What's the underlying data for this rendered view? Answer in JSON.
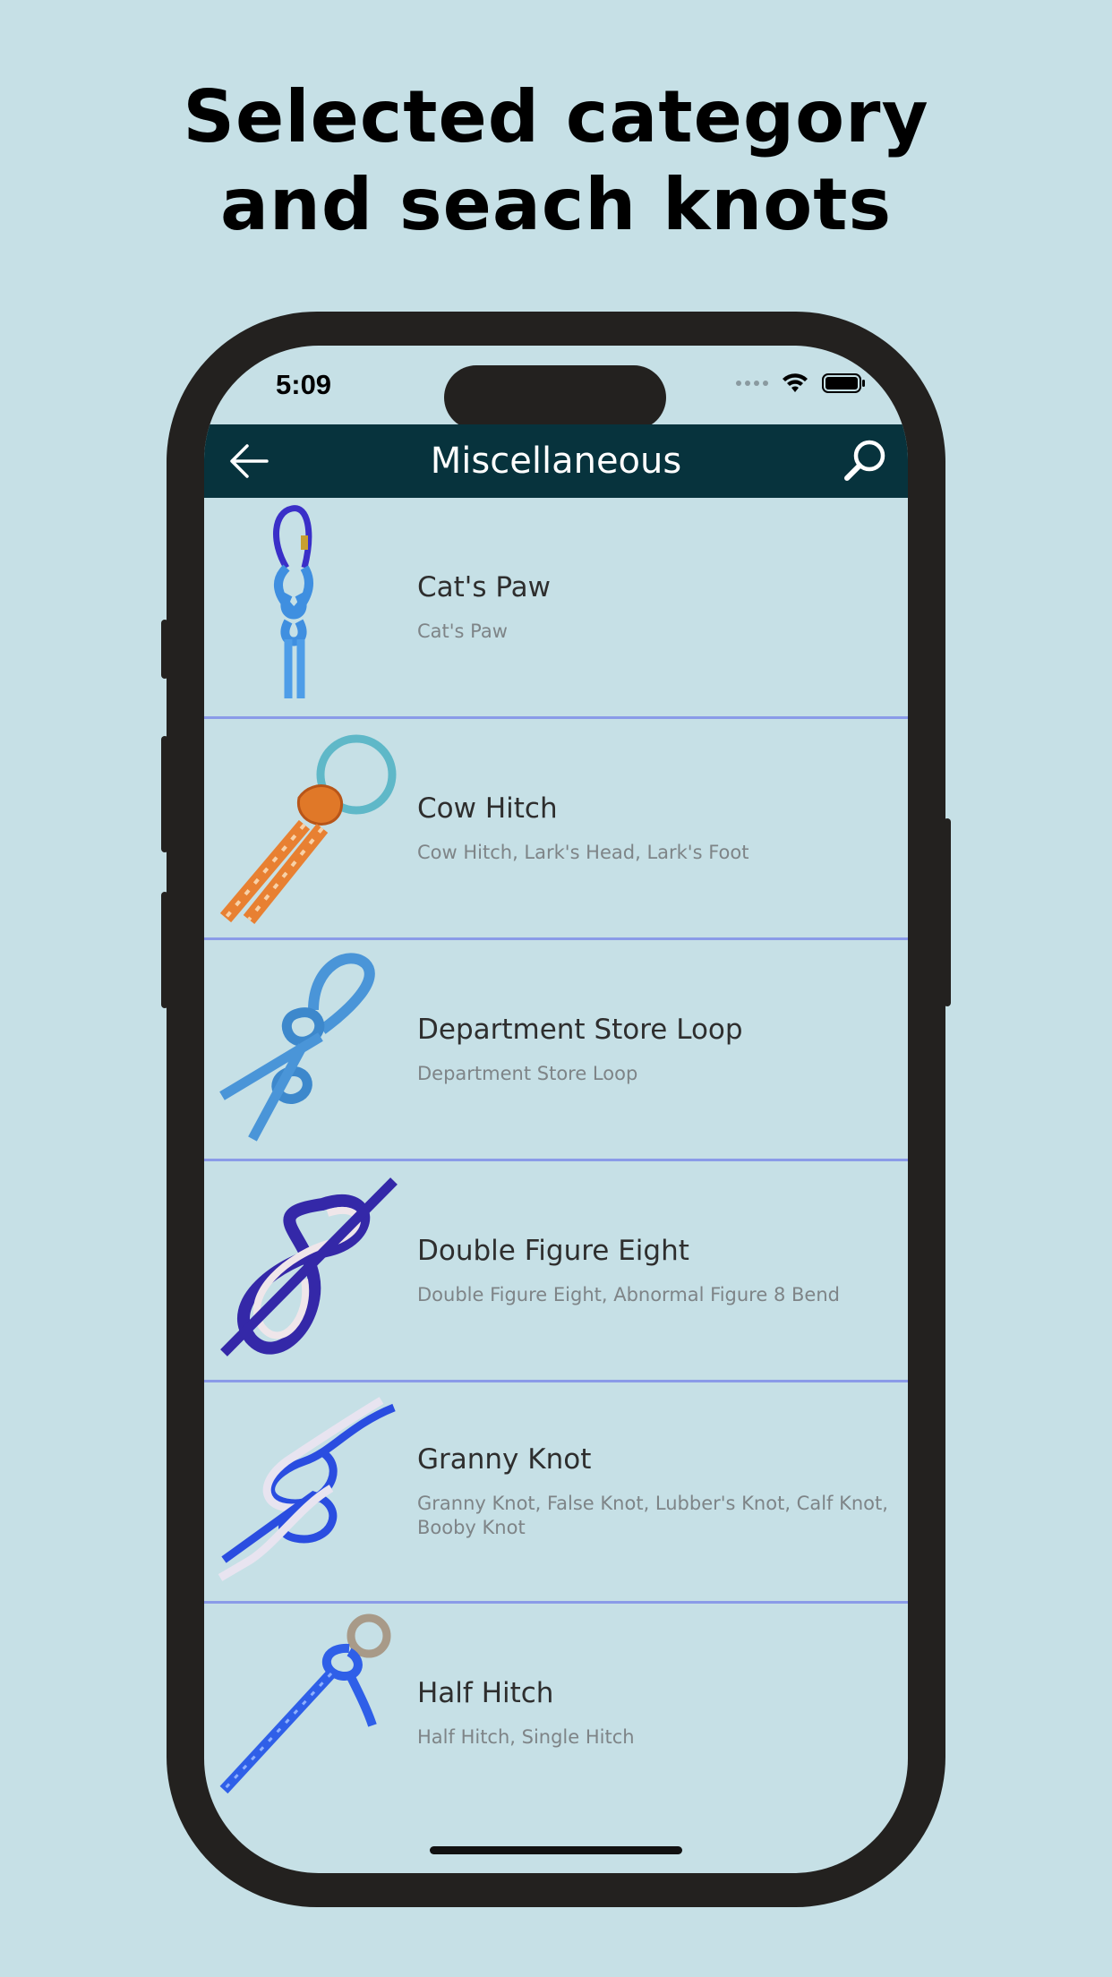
{
  "promo": {
    "line1": "Selected category",
    "line2": "and seach knots"
  },
  "status_bar": {
    "time": "5:09"
  },
  "header": {
    "title": "Miscellaneous",
    "back_icon": "arrow-left-icon",
    "search_icon": "search-icon"
  },
  "knots": [
    {
      "title": "Cat's Paw",
      "subtitle": "Cat's Paw",
      "icon": "cats-paw-knot-icon"
    },
    {
      "title": "Cow Hitch",
      "subtitle": "Cow Hitch, Lark's Head, Lark's Foot",
      "icon": "cow-hitch-knot-icon"
    },
    {
      "title": "Department Store Loop",
      "subtitle": "Department Store Loop",
      "icon": "department-store-loop-knot-icon"
    },
    {
      "title": "Double Figure Eight",
      "subtitle": "Double Figure Eight, Abnormal Figure 8 Bend",
      "icon": "double-figure-eight-knot-icon"
    },
    {
      "title": "Granny Knot",
      "subtitle": "Granny Knot, False Knot, Lubber's Knot, Calf Knot, Booby Knot",
      "icon": "granny-knot-icon"
    },
    {
      "title": "Half Hitch",
      "subtitle": "Half Hitch, Single Hitch",
      "icon": "half-hitch-knot-icon"
    }
  ],
  "colors": {
    "background": "#c6e0e6",
    "app_bar": "#07333d",
    "divider": "#8a9be8",
    "phone_frame": "#23211f"
  }
}
